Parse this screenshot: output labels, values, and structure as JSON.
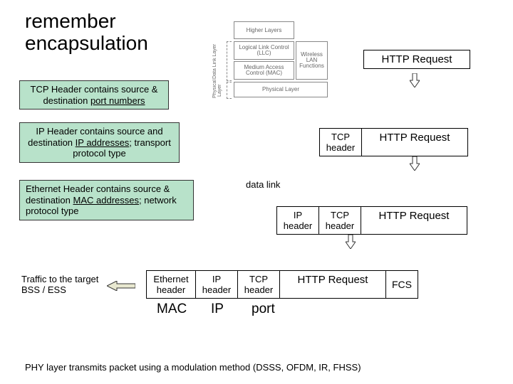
{
  "title_line1": "remember",
  "title_line2": "encapsulation",
  "greenboxes": {
    "tcp": {
      "pre": "TCP Header contains source & destination ",
      "u": "port numbers",
      "post": ""
    },
    "ip": {
      "pre": "IP Header contains source and destination ",
      "u": "IP addresses",
      "post": "; transport protocol type"
    },
    "eth": {
      "pre": "Ethernet Header contains source & destination ",
      "u": "MAC addresses",
      "post": "; network protocol type"
    }
  },
  "boxes": {
    "http": "HTTP Request",
    "tcp": "TCP header",
    "ip": "IP header",
    "eth": "Ethernet header",
    "fcs": "FCS"
  },
  "labels": {
    "datalink": "data link",
    "traffic": "Traffic to the target BSS / ESS",
    "mac": "MAC",
    "iplabel": "IP",
    "port": "port"
  },
  "osi": {
    "hl": "Higher Layers",
    "llc": "Logical Link Control (LLC)",
    "mac": "Medium Access Control (MAC)",
    "wlan": "Wireless LAN Functions",
    "phy": "Physical Layer",
    "dll": "Data Link Layer",
    "plv": "Physical Layer"
  },
  "footer": "PHY layer transmits packet using a modulation method (DSSS, OFDM, IR, FHSS)"
}
